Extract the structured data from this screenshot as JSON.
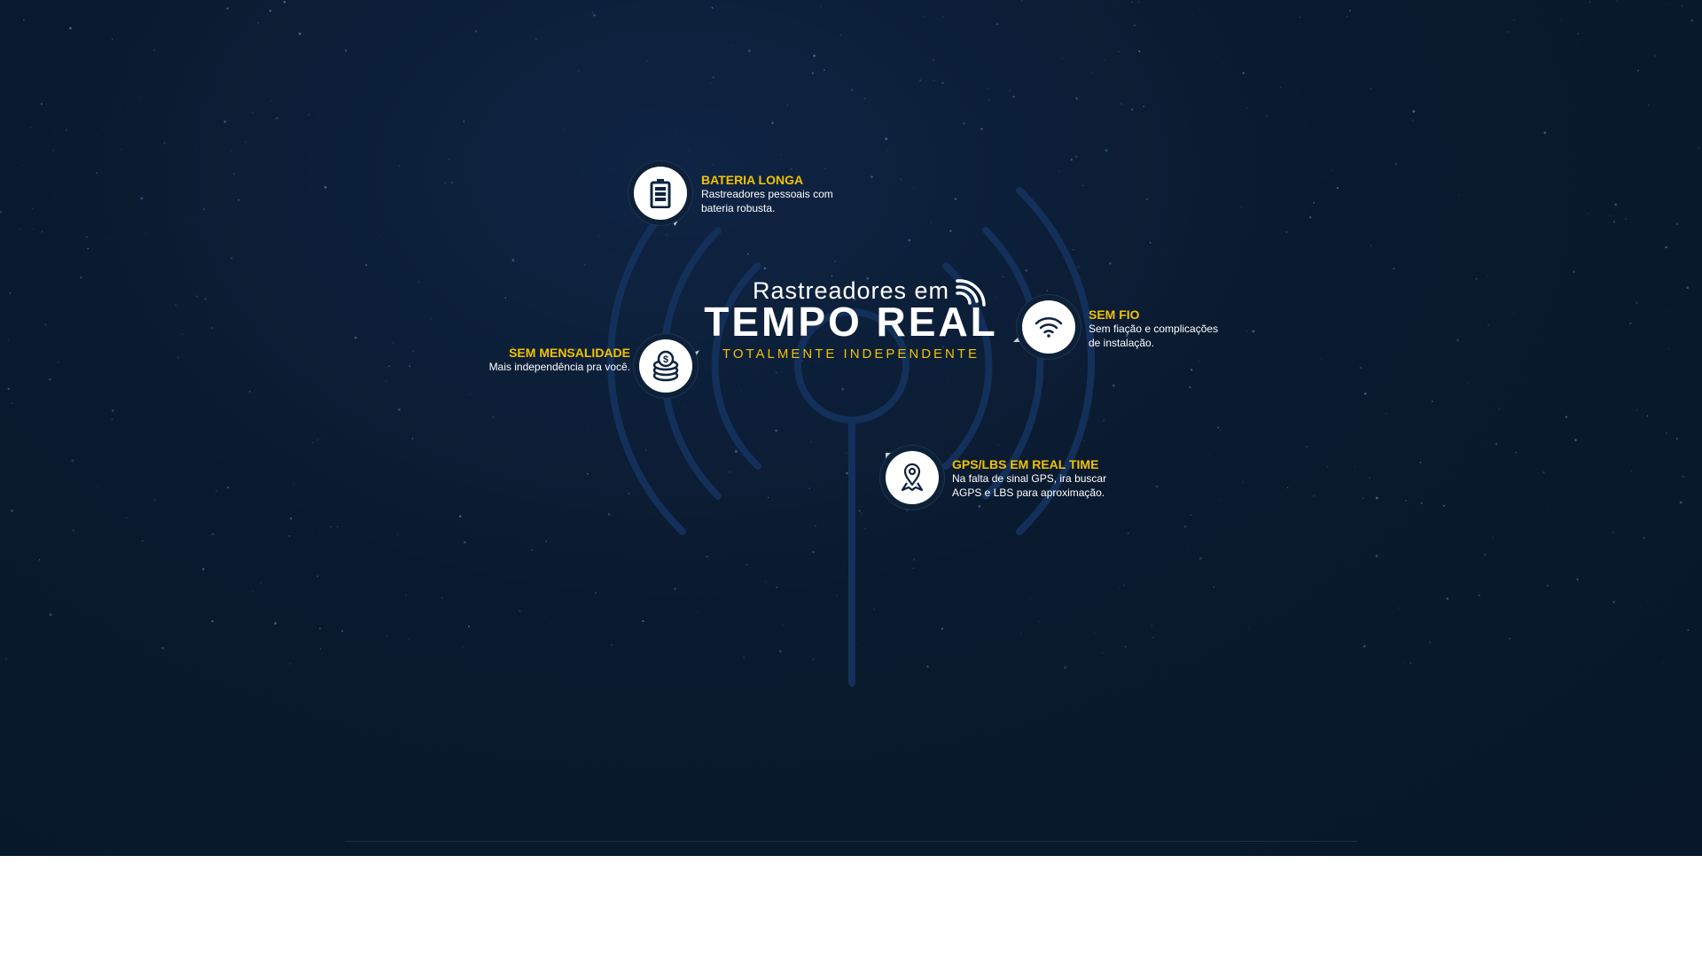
{
  "hero": {
    "title_line1": "Rastreadores em",
    "title_line2": "TEMPO REAL",
    "subtitle": "TOTALMENTE INDEPENDENTE"
  },
  "features": [
    {
      "title": "BATERIA LONGA",
      "desc1": "Rastreadores pessoais com",
      "desc2": "bateria robusta.",
      "icon": "battery-icon"
    },
    {
      "title": "SEM MENSALIDADE",
      "desc1": "Mais independência pra você.",
      "icon": "coins-icon"
    },
    {
      "title": "SEM FIO",
      "desc1": "Sem fiação e complicações",
      "desc2": "de instalação.",
      "icon": "wifi-icon"
    },
    {
      "title": "GPS/LBS EM REAL TIME",
      "desc1": "Na falta de sinal GPS, ira buscar",
      "desc2": "AGPS e LBS para aproximação.",
      "icon": "map-pin-icon"
    }
  ],
  "colors": {
    "accent": "#f2c200",
    "background": "#0a1a2e",
    "arc": "#13305a",
    "icon": "#0d2340"
  }
}
